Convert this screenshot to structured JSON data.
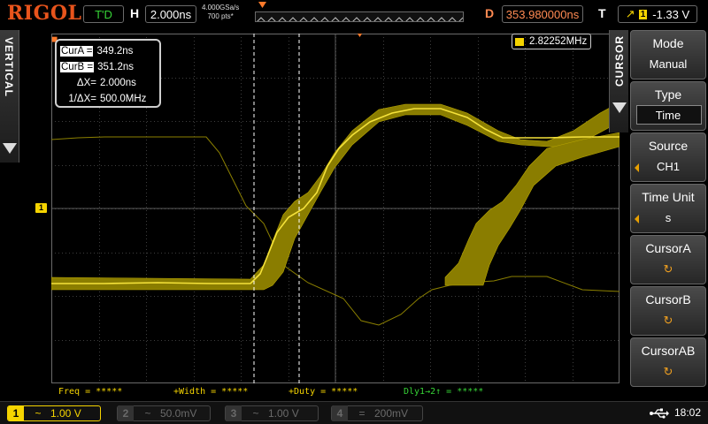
{
  "header": {
    "brand": "RIGOL",
    "run_state": "T'D",
    "h_label": "H",
    "timebase": "2.000ns",
    "sample_rate": "4.000GSa/s",
    "memory_depth": "700 pts*",
    "d_label": "D",
    "trigger_delay": "353.980000ns",
    "t_label": "T",
    "trigger_source": "1",
    "trigger_level": "-1.33 V"
  },
  "left_tab": {
    "label": "VERTICAL"
  },
  "cursor_readout": {
    "cura_label": "CurA =",
    "cura_value": "349.2ns",
    "curb_label": "CurB =",
    "curb_value": "351.2ns",
    "dx_label": "ΔX=",
    "dx_value": "2.000ns",
    "inv_dx_label": "1/ΔX=",
    "inv_dx_value": "500.0MHz"
  },
  "frequency_counter": {
    "value": "2.82252MHz"
  },
  "channel_marker": "1",
  "measurements": {
    "freq": "Freq = *****",
    "width": "+Width = *****",
    "duty": "+Duty = *****",
    "delay": "Dly1→2↑ = *****"
  },
  "right_tab": {
    "label": "CURSOR"
  },
  "menu": {
    "mode_title": "Mode",
    "mode_value": "Manual",
    "type_title": "Type",
    "type_value": "Time",
    "source_title": "Source",
    "source_value": "CH1",
    "time_unit_title": "Time Unit",
    "time_unit_value": "s",
    "cursor_a": "CursorA",
    "cursor_b": "CursorB",
    "cursor_ab": "CursorAB",
    "knob_glyph": "↻"
  },
  "channels": [
    {
      "num": "1",
      "coupling": "~",
      "scale": "1.00 V",
      "active": true
    },
    {
      "num": "2",
      "coupling": "~",
      "scale": "50.0mV",
      "active": false
    },
    {
      "num": "3",
      "coupling": "~",
      "scale": "1.00 V",
      "active": false
    },
    {
      "num": "4",
      "coupling": "=",
      "scale": "200mV",
      "active": false
    }
  ],
  "status": {
    "time": "18:02"
  },
  "colors": {
    "ch1": "#f5d400",
    "brand": "#e8541c",
    "trigger_delay": "#ff8a52",
    "run_state": "#36d336",
    "measure_green": "#36d336",
    "grid": "#4a4a4a"
  },
  "icons": {
    "trigger_slope": "rising-edge-icon",
    "knob": "rotary-knob-icon",
    "usb": "usb-icon",
    "menu_arrow": "triangle-left-icon"
  }
}
